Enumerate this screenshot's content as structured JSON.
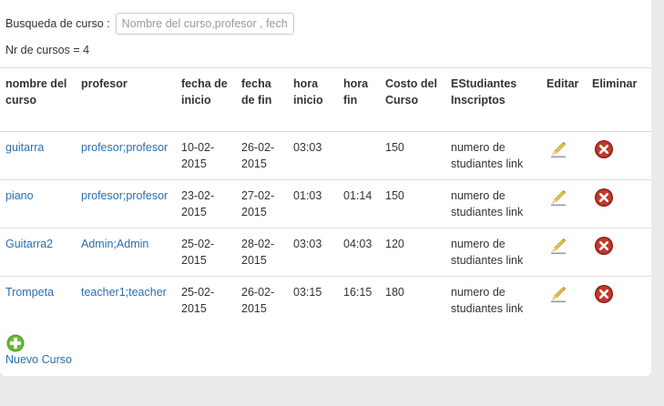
{
  "search": {
    "label": "Busqueda de curso :",
    "placeholder": "Nombre del curso,profesor , fech"
  },
  "count_text": "Nr de cursos = 4",
  "table": {
    "headers": [
      "nombre del curso",
      "profesor",
      "fecha de inicio",
      "fecha de fin",
      "hora inicio",
      "hora fin",
      "Costo del Curso",
      "EStudiantes Inscriptos",
      "Editar",
      "Eliminar"
    ],
    "rows": [
      {
        "nombre": "guitarra",
        "profesor": "profesor;profesor",
        "inicio": "10-02-2015",
        "fin": "26-02-2015",
        "hora_inicio": "03:03",
        "hora_fin": "",
        "costo": "150",
        "estudiantes": "numero de studiantes link"
      },
      {
        "nombre": "piano",
        "profesor": "profesor;profesor",
        "inicio": "23-02-2015",
        "fin": "27-02-2015",
        "hora_inicio": "01:03",
        "hora_fin": "01:14",
        "costo": "150",
        "estudiantes": "numero de studiantes link"
      },
      {
        "nombre": "Guitarra2",
        "profesor": "Admin;Admin",
        "inicio": "25-02-2015",
        "fin": "28-02-2015",
        "hora_inicio": "03:03",
        "hora_fin": "04:03",
        "costo": "120",
        "estudiantes": "numero de studiantes link"
      },
      {
        "nombre": "Trompeta",
        "profesor": "teacher1;teacher",
        "inicio": "25-02-2015",
        "fin": "26-02-2015",
        "hora_inicio": "03:15",
        "hora_fin": "16:15",
        "costo": "180",
        "estudiantes": "numero de studiantes link"
      }
    ]
  },
  "add_label": "Nuevo Curso",
  "icons": {
    "edit": "pencil-icon",
    "delete": "delete-x-icon",
    "add": "plus-circle-icon"
  },
  "colors": {
    "link": "#2a6fb0",
    "delete": "#b3271f",
    "add": "#5aa02c"
  }
}
